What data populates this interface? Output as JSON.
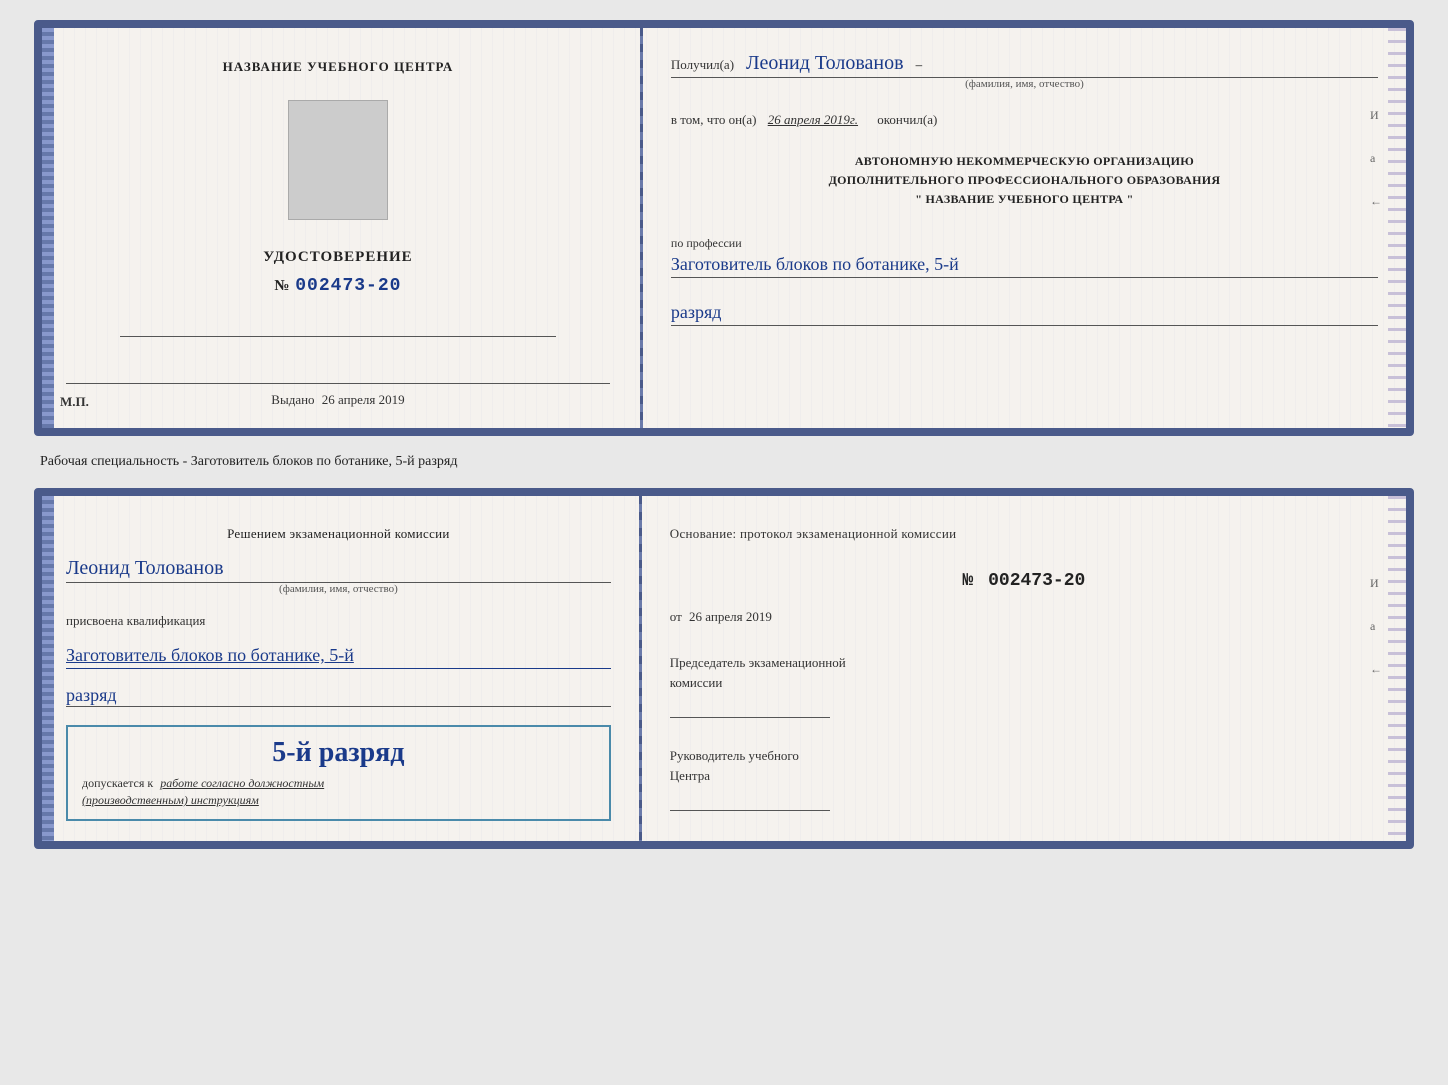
{
  "top_cert": {
    "left": {
      "center_title": "НАЗВАНИЕ УЧЕБНОГО ЦЕНТРА",
      "doc_label": "УДОСТОВЕРЕНИЕ",
      "doc_number_prefix": "№",
      "doc_number": "002473-20",
      "issued_prefix": "Выдано",
      "issued_date": "26 апреля 2019",
      "mp_label": "М.П."
    },
    "right": {
      "received_prefix": "Получил(а)",
      "recipient_name": "Леонид Толованов",
      "name_label": "(фамилия, имя, отчество)",
      "date_prefix": "в том, что он(а)",
      "date_value": "26 апреля 2019г.",
      "finished_word": "окончил(а)",
      "org_line1": "АВТОНОМНУЮ НЕКОММЕРЧЕСКУЮ ОРГАНИЗАЦИЮ",
      "org_line2": "ДОПОЛНИТЕЛЬНОГО ПРОФЕССИОНАЛЬНОГО ОБРАЗОВАНИЯ",
      "org_line3": "\" НАЗВАНИЕ УЧЕБНОГО ЦЕНТРА \"",
      "profession_label": "по профессии",
      "profession_value": "Заготовитель блоков по ботанике, 5-й",
      "rank_value": "разряд"
    }
  },
  "middle_label": "Рабочая специальность - Заготовитель блоков по ботанике, 5-й разряд",
  "bottom_cert": {
    "left": {
      "decision_text": "Решением экзаменационной комиссии",
      "person_name": "Леонид Толованов",
      "name_label": "(фамилия, имя, отчество)",
      "assigned_text": "присвоена квалификация",
      "profession_value": "Заготовитель блоков по ботанике, 5-й",
      "rank_value": "разряд",
      "highlight_rank": "5-й разряд",
      "admit_prefix": "допускается к",
      "admit_text": "работе согласно должностным",
      "admit_text2": "(производственным) инструкциям"
    },
    "right": {
      "basis_text": "Основание: протокол экзаменационной комиссии",
      "protocol_prefix": "№",
      "protocol_number": "002473-20",
      "from_prefix": "от",
      "from_date": "26 апреля 2019",
      "chairman_title": "Председатель экзаменационной",
      "chairman_title2": "комиссии",
      "head_title1": "Руководитель учебного",
      "head_title2": "Центра"
    }
  },
  "side_marks": {
    "mark1": "И",
    "mark2": "а",
    "mark3": "←"
  }
}
